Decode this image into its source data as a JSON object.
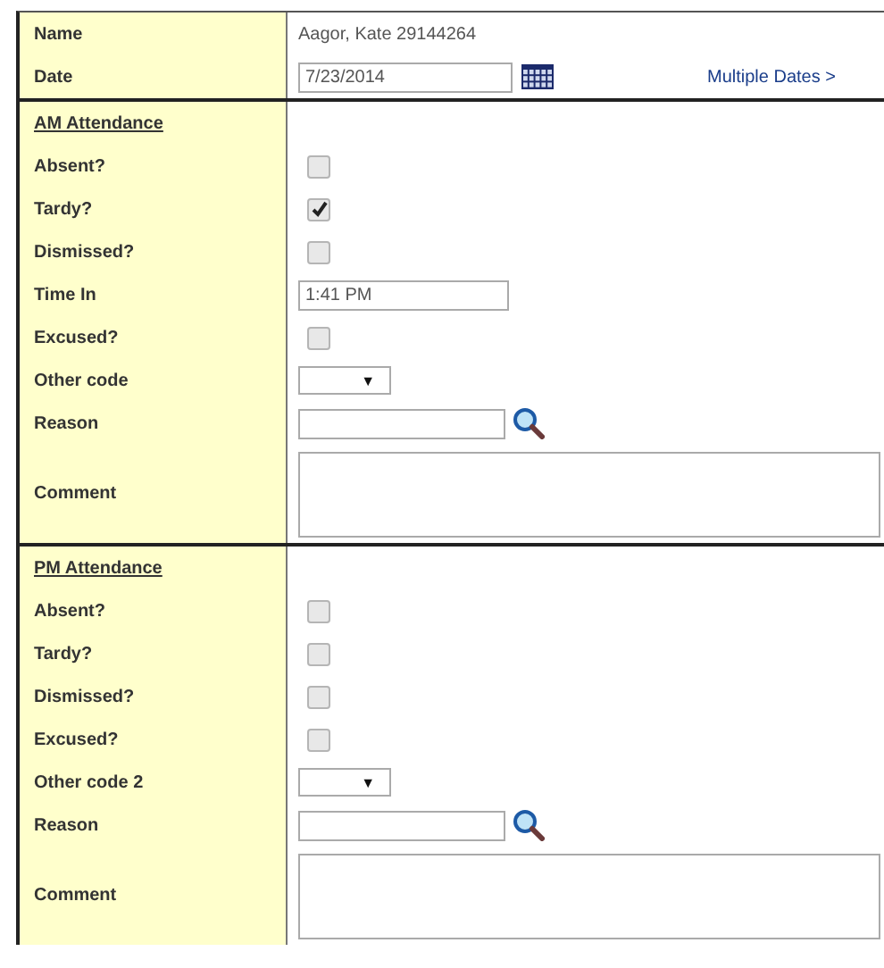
{
  "header": {
    "name_label": "Name",
    "name_value": "Aagor, Kate  29144264",
    "date_label": "Date",
    "date_value": "7/23/2014",
    "multiple_dates_link": "Multiple Dates >"
  },
  "sections": [
    {
      "title": "AM Attendance",
      "rows": [
        {
          "kind": "checkbox",
          "label": "Absent?",
          "checked": false
        },
        {
          "kind": "checkbox",
          "label": "Tardy?",
          "checked": true
        },
        {
          "kind": "checkbox",
          "label": "Dismissed?",
          "checked": false
        },
        {
          "kind": "text",
          "label": "Time In",
          "value": "1:41 PM"
        },
        {
          "kind": "checkbox",
          "label": "Excused?",
          "checked": false
        },
        {
          "kind": "select",
          "label": "Other code",
          "arrow": "▼"
        },
        {
          "kind": "lookup",
          "label": "Reason"
        },
        {
          "kind": "textarea",
          "label": "Comment"
        }
      ]
    },
    {
      "title": "PM Attendance",
      "rows": [
        {
          "kind": "checkbox",
          "label": "Absent?",
          "checked": false
        },
        {
          "kind": "checkbox",
          "label": "Tardy?",
          "checked": false
        },
        {
          "kind": "checkbox",
          "label": "Dismissed?",
          "checked": false
        },
        {
          "kind": "checkbox",
          "label": "Excused?",
          "checked": false
        },
        {
          "kind": "select",
          "label": "Other code 2",
          "arrow": "▼"
        },
        {
          "kind": "lookup",
          "label": "Reason"
        },
        {
          "kind": "textarea",
          "label": "Comment"
        }
      ]
    }
  ]
}
